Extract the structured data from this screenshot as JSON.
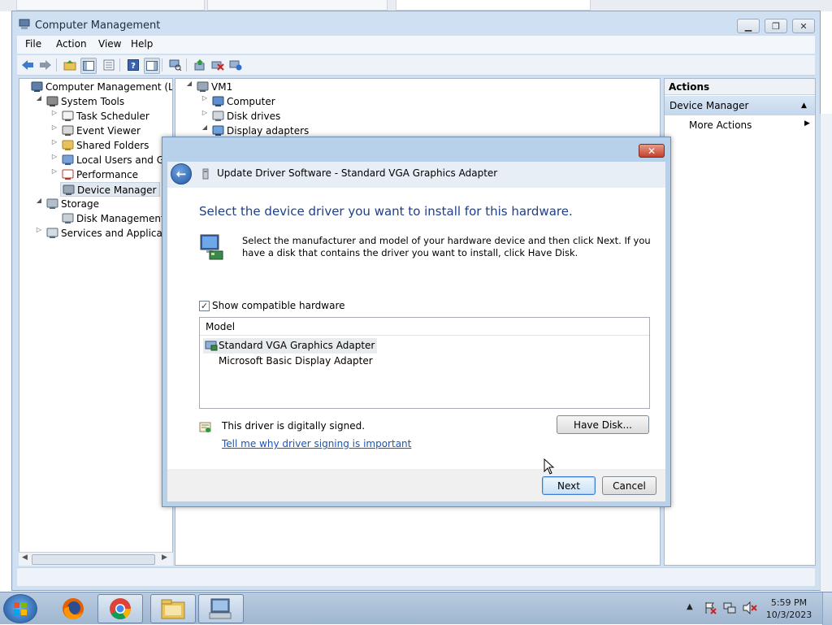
{
  "window": {
    "title": "Computer Management"
  },
  "menu": [
    "File",
    "Action",
    "View",
    "Help"
  ],
  "left_tree": [
    {
      "label": "Computer Management (Local",
      "icon": "computer-management-icon",
      "expander": "",
      "indent": 0
    },
    {
      "label": "System Tools",
      "icon": "tools-icon",
      "expander": "◢",
      "indent": 1
    },
    {
      "label": "Task Scheduler",
      "icon": "clock-icon",
      "expander": "▷",
      "indent": 2
    },
    {
      "label": "Event Viewer",
      "icon": "event-viewer-icon",
      "expander": "▷",
      "indent": 2
    },
    {
      "label": "Shared Folders",
      "icon": "shared-folder-icon",
      "expander": "▷",
      "indent": 2
    },
    {
      "label": "Local Users and Group",
      "icon": "users-icon",
      "expander": "▷",
      "indent": 2
    },
    {
      "label": "Performance",
      "icon": "performance-icon",
      "expander": "▷",
      "indent": 2
    },
    {
      "label": "Device Manager",
      "icon": "device-manager-icon",
      "expander": "",
      "indent": 2,
      "selected": true
    },
    {
      "label": "Storage",
      "icon": "storage-icon",
      "expander": "◢",
      "indent": 1
    },
    {
      "label": "Disk Management",
      "icon": "disk-icon",
      "expander": "",
      "indent": 2
    },
    {
      "label": "Services and Applications",
      "icon": "services-icon",
      "expander": "▷",
      "indent": 1
    }
  ],
  "device_tree": [
    {
      "label": "VM1",
      "icon": "computer-icon",
      "expander": "◢",
      "indent": 0
    },
    {
      "label": "Computer",
      "icon": "monitor-icon",
      "expander": "▷",
      "indent": 1
    },
    {
      "label": "Disk drives",
      "icon": "disk-drive-icon",
      "expander": "▷",
      "indent": 1
    },
    {
      "label": "Display adapters",
      "icon": "display-adapter-icon",
      "expander": "◢",
      "indent": 1
    }
  ],
  "actions": {
    "header": "Actions",
    "section": "Device Manager",
    "more": "More Actions"
  },
  "dialog": {
    "title": "Update Driver Software - Standard VGA Graphics Adapter",
    "heading": "Select the device driver you want to install for this hardware.",
    "description": "Select the manufacturer and model of your hardware device and then click Next. If you have a disk that contains the driver you want to install, click Have Disk.",
    "checkbox_label": "Show compatible hardware",
    "checkbox_checked": true,
    "list_header": "Model",
    "models": [
      {
        "label": "Standard VGA Graphics Adapter",
        "selected": true
      },
      {
        "label": "Microsoft Basic Display Adapter",
        "selected": false
      }
    ],
    "signed_text": "This driver is digitally signed.",
    "link_text": "Tell me why driver signing is important",
    "have_disk": "Have Disk...",
    "next": "Next",
    "cancel": "Cancel"
  },
  "taskbar": {
    "time": "5:59 PM",
    "date": "10/3/2023"
  },
  "colors": {
    "heading": "#1e3f8a",
    "link": "#1a55b8",
    "window_frame": "#cfe0f3"
  }
}
